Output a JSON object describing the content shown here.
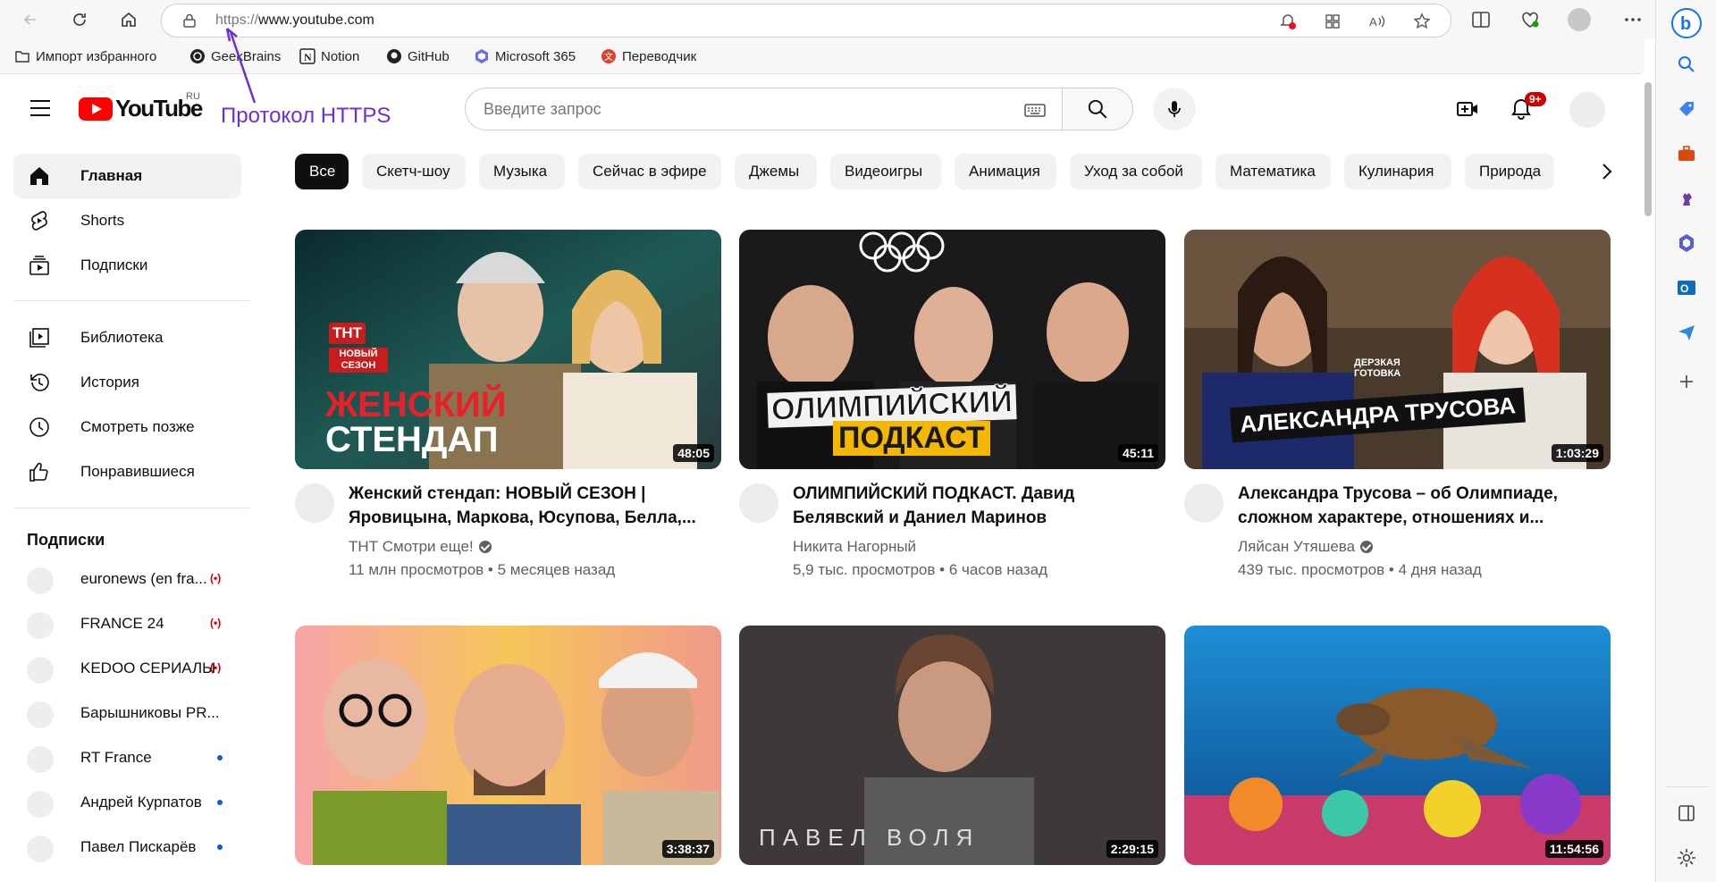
{
  "browser": {
    "url_protocol": "https://",
    "url_host": "www.youtube.com",
    "bookmarks": [
      "Импорт избранного",
      "GeekBrains",
      "Notion",
      "GitHub",
      "Microsoft 365",
      "Переводчик"
    ]
  },
  "annotation": {
    "text": "Протокол HTTPS",
    "color": "#6a2fd6"
  },
  "youtube": {
    "logo_word": "YouTube",
    "region": "RU",
    "search_placeholder": "Введите запрос",
    "notifications_badge": "9+"
  },
  "sidebar": {
    "items": [
      {
        "label": "Главная",
        "icon": "home-icon"
      },
      {
        "label": "Shorts",
        "icon": "shorts-icon"
      },
      {
        "label": "Подписки",
        "icon": "subscriptions-icon"
      },
      {
        "label": "Библиотека",
        "icon": "library-icon"
      },
      {
        "label": "История",
        "icon": "history-icon"
      },
      {
        "label": "Смотреть позже",
        "icon": "watch-later-icon"
      },
      {
        "label": "Понравившиеся",
        "icon": "like-icon"
      }
    ],
    "subscriptions_heading": "Подписки",
    "channels": [
      {
        "name": "euronews (en fra...",
        "status": "live"
      },
      {
        "name": "FRANCE 24",
        "status": "live"
      },
      {
        "name": "KEDOO СЕРИАЛЫ",
        "status": "live"
      },
      {
        "name": "Барышниковы PR...",
        "status": ""
      },
      {
        "name": "RT France",
        "status": "new"
      },
      {
        "name": "Андрей Курпатов",
        "status": "new"
      },
      {
        "name": "Павел Пискарёв",
        "status": "new"
      }
    ]
  },
  "chips": [
    "Все",
    "Скетч-шоу",
    "Музыка",
    "Сейчас в эфире",
    "Джемы",
    "Видеоигры",
    "Анимация",
    "Уход за собой",
    "Математика",
    "Кулинария",
    "Природа"
  ],
  "videos": [
    {
      "title": "Женский стендап: НОВЫЙ СЕЗОН | Яровицына, Маркова, Юсупова, Белла,...",
      "channel": "ТНТ Смотри еще!",
      "verified": true,
      "views": "11 млн просмотров",
      "age": "5 месяцев назад",
      "duration": "48:05",
      "thumb_logo": "ТНТ",
      "thumb_badge": "НОВЫЙ СЕЗОН",
      "thumb_text1": "ЖЕНСКИЙ",
      "thumb_text2": "СТЕНДАП"
    },
    {
      "title": "ОЛИМПИЙСКИЙ ПОДКАСТ. Давид Белявский и Даниел Маринов",
      "channel": "Никита Нагорный",
      "verified": false,
      "views": "5,9 тыс. просмотров",
      "age": "6 часов назад",
      "duration": "45:11",
      "thumb_text1": "ОЛИМПИЙСКИЙ",
      "thumb_text2": "ПОДКАСТ"
    },
    {
      "title": "Александра Трусова – об Олимпиаде, сложном характере, отношениях и...",
      "channel": "Ляйсан Утяшева",
      "verified": true,
      "views": "439 тыс. просмотров",
      "age": "4 дня назад",
      "duration": "1:03:29",
      "thumb_text1": "АЛЕКСАНДРА ТРУСОВА",
      "thumb_text2": "ДЕРЗКАЯ ГОТОВКА"
    },
    {
      "duration": "3:38:37"
    },
    {
      "duration": "2:29:15",
      "thumb_text1": "ПАВЕЛ ВОЛЯ"
    },
    {
      "duration": "11:54:56"
    }
  ]
}
